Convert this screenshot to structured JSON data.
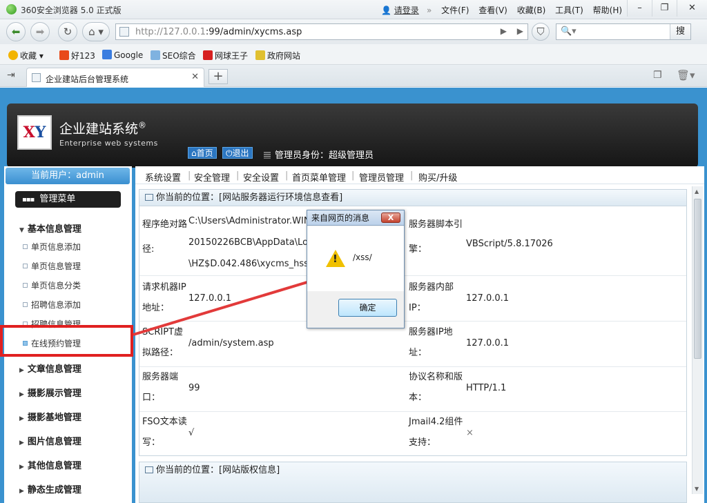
{
  "browser": {
    "title": "360安全浏览器 5.0 正式版",
    "login": "请登录",
    "menu": [
      "文件(F)",
      "查看(V)",
      "收藏(B)",
      "工具(T)",
      "帮助(H)"
    ],
    "url_host": "http://127.0.0.1",
    "url_rest": ":99/admin/xycms.asp",
    "search_button": "搜",
    "bookmarks": [
      "收藏",
      "好123",
      "Google",
      "SEO综合",
      "网球王子",
      "政府网站"
    ],
    "tab_title": "企业建站后台管理系统"
  },
  "site": {
    "logo_text_a": "X",
    "logo_text_b": "Y",
    "name": "企业建站系统",
    "reg_mark": "®",
    "name_en": "Enterprise web systems",
    "home_btn": "首页",
    "logout_btn": "退出",
    "admin_role": "管理员身份：超级管理员"
  },
  "sidebar": {
    "current_user": "当前用户：admin",
    "menu_title": "管理菜单",
    "section_basic": "基本信息管理",
    "sub_items": [
      "单页信息添加",
      "单页信息管理",
      "单页信息分类",
      "招聘信息添加",
      "招聘信息管理",
      "在线预约管理"
    ],
    "sections": [
      "文章信息管理",
      "摄影展示管理",
      "摄影基地管理",
      "图片信息管理",
      "其他信息管理",
      "静态生成管理"
    ]
  },
  "topnav": [
    "系统设置",
    "安全管理",
    "安全设置",
    "首页菜单管理",
    "管理员管理",
    "购买/升级"
  ],
  "panel": {
    "title": "你当前的位置：[网站服务器运行环境信息查看]",
    "rows": [
      {
        "l1": "程序绝对路",
        "l2": "径:",
        "v": [
          "C:\\Users\\Administrator.WIN",
          "20150226BCB\\AppData\\Loc",
          "\\HZ$D.042.486\\xycms_hssy"
        ],
        "r1": "服务器脚本引",
        "r2": "擎：",
        "rv": "VBScript/5.8.17026"
      },
      {
        "l1": "请求机器IP",
        "l2": "地址：",
        "v": [
          "127.0.0.1"
        ],
        "r1": "服务器内部",
        "r2": "IP：",
        "rv": "127.0.0.1"
      },
      {
        "l1": "SCRIPT虚",
        "l2": "拟路径：",
        "v": [
          "/admin/system.asp"
        ],
        "r1": "服务器IP地",
        "r2": "址：",
        "rv": "127.0.0.1"
      },
      {
        "l1": "服务器端",
        "l2": "口：",
        "v": [
          "99"
        ],
        "r1": "协议名称和版",
        "r2": "本：",
        "rv": "HTTP/1.1"
      },
      {
        "l1": "FSO文本读",
        "l2": "写：",
        "v": [
          "√"
        ],
        "r1": "Jmail4.2组件",
        "r2": "支持：",
        "rv": "×"
      }
    ]
  },
  "panel2_title": "你当前的位置：[网站版权信息]",
  "dialog": {
    "title": "来自网页的消息",
    "close": "X",
    "message": "/xss/",
    "ok": "确定",
    "warn_mark": "!"
  },
  "colors": {
    "page_bg": "#3a92cf",
    "highlight_box": "#e02020",
    "arrow": "#e23a3a"
  }
}
